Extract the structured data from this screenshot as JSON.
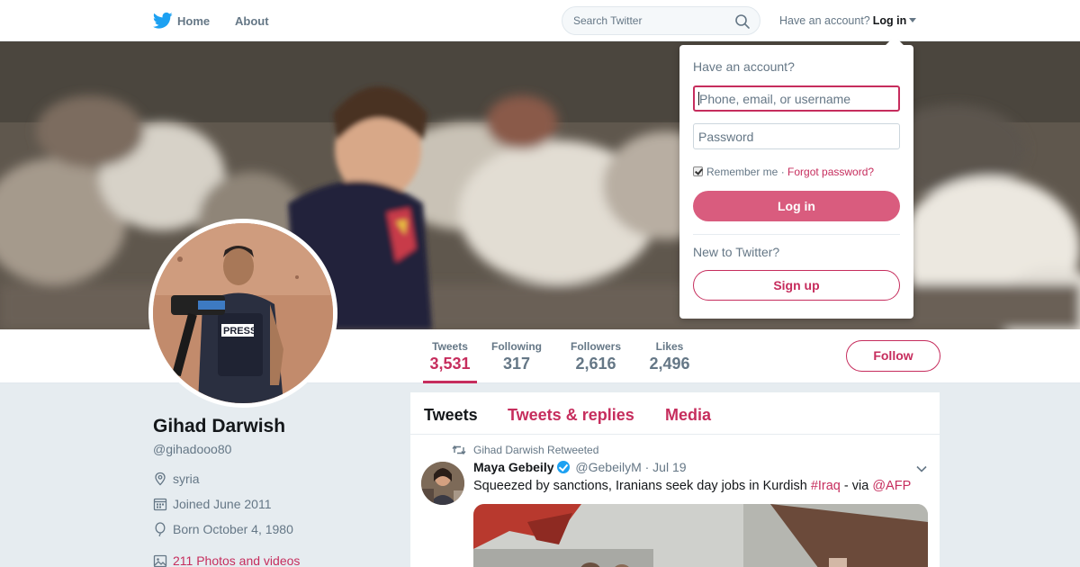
{
  "nav": {
    "home": "Home",
    "about": "About",
    "search_placeholder": "Search Twitter",
    "have_account": "Have an account?",
    "login": "Log in"
  },
  "profile": {
    "name": "Gihad Darwish",
    "handle": "@gihadooo80",
    "location": "syria",
    "joined": "Joined June 2011",
    "born": "Born October 4, 1980",
    "photos": "211 Photos and videos"
  },
  "stats": [
    {
      "label": "Tweets",
      "value": "3,531"
    },
    {
      "label": "Following",
      "value": "317"
    },
    {
      "label": "Followers",
      "value": "2,616"
    },
    {
      "label": "Likes",
      "value": "2,496"
    }
  ],
  "follow_label": "Follow",
  "timeline": {
    "tabs": [
      "Tweets",
      "Tweets & replies",
      "Media"
    ],
    "tweet": {
      "retweeted_by": "Gihad Darwish Retweeted",
      "author": "Maya Gebeily",
      "author_handle": "@GebeilyM",
      "date": "· Jul 19",
      "text_before": "Squeezed by sanctions, Iranians seek day jobs in Kurdish ",
      "hashtag": "#Iraq",
      "text_mid": " - via ",
      "mention": "@AFP"
    }
  },
  "login_dropdown": {
    "title": "Have an account?",
    "username_placeholder": "Phone, email, or username",
    "password_placeholder": "Password",
    "remember": "Remember me",
    "separator": " · ",
    "forgot": "Forgot password?",
    "login_button": "Log in",
    "new_to": "New to Twitter?",
    "signup_button": "Sign up"
  },
  "colors": {
    "accent": "#c62d5d",
    "login_button": "#d95c7e",
    "twitter_blue": "#1da1f2",
    "background": "#e6ecf0"
  }
}
